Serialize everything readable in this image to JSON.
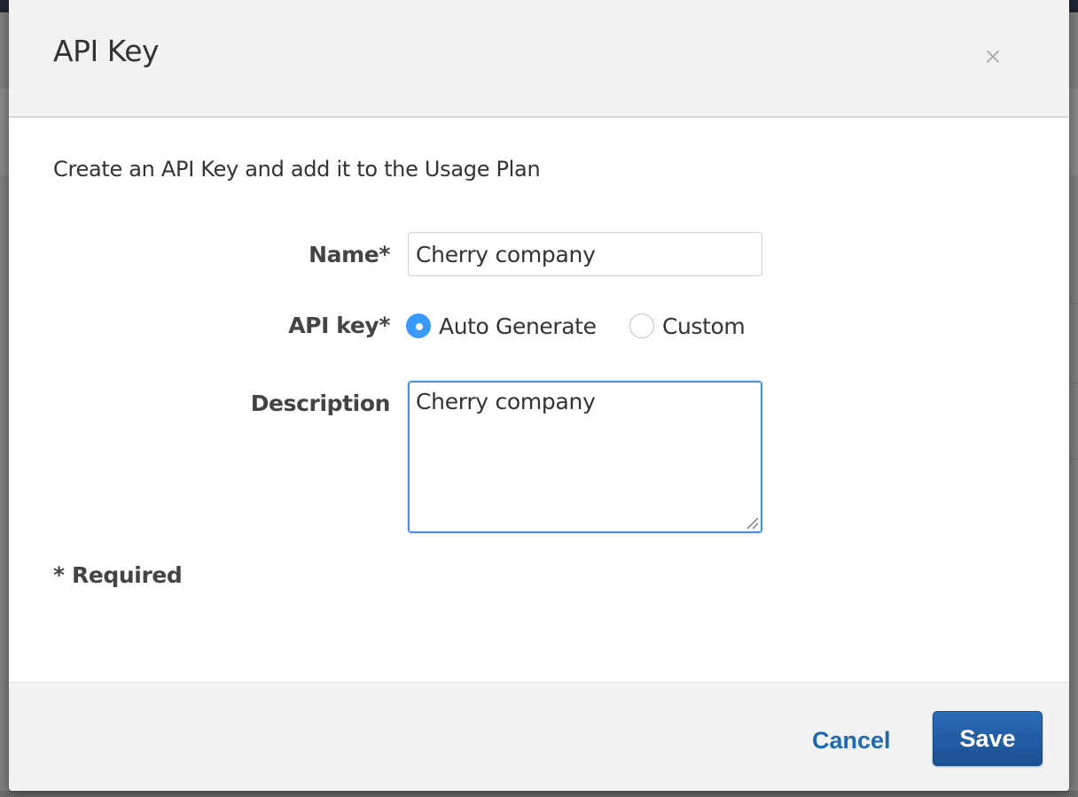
{
  "dialog": {
    "title": "API Key",
    "close_glyph": "×",
    "intro": "Create an API Key and add it to the Usage Plan"
  },
  "form": {
    "name_label": "Name*",
    "name_value": "Cherry company",
    "api_key_label": "API key*",
    "api_key_options": [
      {
        "label": "Auto Generate",
        "selected": true
      },
      {
        "label": "Custom",
        "selected": false
      }
    ],
    "description_label": "Description",
    "description_value": "Cherry company",
    "required_note": "* Required"
  },
  "footer": {
    "cancel_label": "Cancel",
    "save_label": "Save"
  },
  "colors": {
    "accent": "#3b99fc",
    "primary_button": "#1b4f91",
    "link": "#1f69b3"
  },
  "icons": {
    "close": "close-icon",
    "resize": "resize-handle-icon",
    "radio_selected": "radio-checked-icon",
    "radio_unselected": "radio-unchecked-icon"
  }
}
